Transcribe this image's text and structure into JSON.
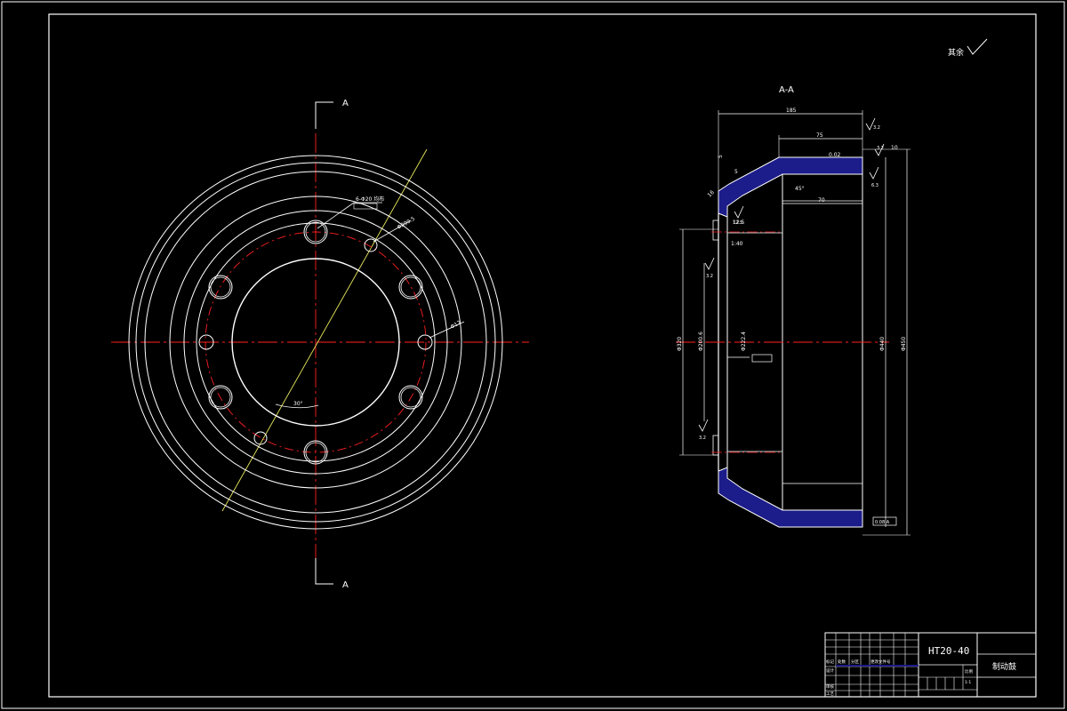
{
  "front_view": {
    "section_label_top": "A",
    "section_label_bottom": "A",
    "callout_bolt_holes": "6-Φ20 均布",
    "callout_pcd": "Φ290.5",
    "callout_angle": "30°",
    "callout_small_holes": "2-Φ12",
    "callout_side": "Φ12"
  },
  "section_view": {
    "title": "A-A",
    "dims": {
      "overall_depth": "185",
      "rim_width": "75",
      "inner_width": "70",
      "chamfer_angle": "45°",
      "wall_thickness": "5",
      "hub_offset": "5",
      "rim_lip": "10",
      "bore_dia": "Φ222.4",
      "pilot_dia": "Φ200.6",
      "flange_dia": "Φ320",
      "drum_inner_dia": "Φ440",
      "drum_outer_dia": "Φ450",
      "hub_face": "12.5",
      "thickness": "16",
      "taper": "1:40"
    },
    "roughness_values": [
      "3.2",
      "6.3",
      "12.5",
      "3.2",
      "3.2",
      "3.2"
    ],
    "tolerance_frame": "0.02",
    "tolerance_frame_bottom": "0.08 A"
  },
  "surface_note": "其余",
  "title_block": {
    "material": "HT20-40",
    "part_name": "制动鼓",
    "scale_label": "比例",
    "sheet": "1:1",
    "labels": [
      "标记",
      "处数",
      "分区",
      "更改文件号"
    ],
    "designer_label": "设计",
    "review_label": "审核",
    "craft_label": "工艺"
  },
  "colors": {
    "line": "#ffffff",
    "center": "#ff2020",
    "section_plane": "#e8e85a",
    "hatch": "#1c1c8a"
  }
}
